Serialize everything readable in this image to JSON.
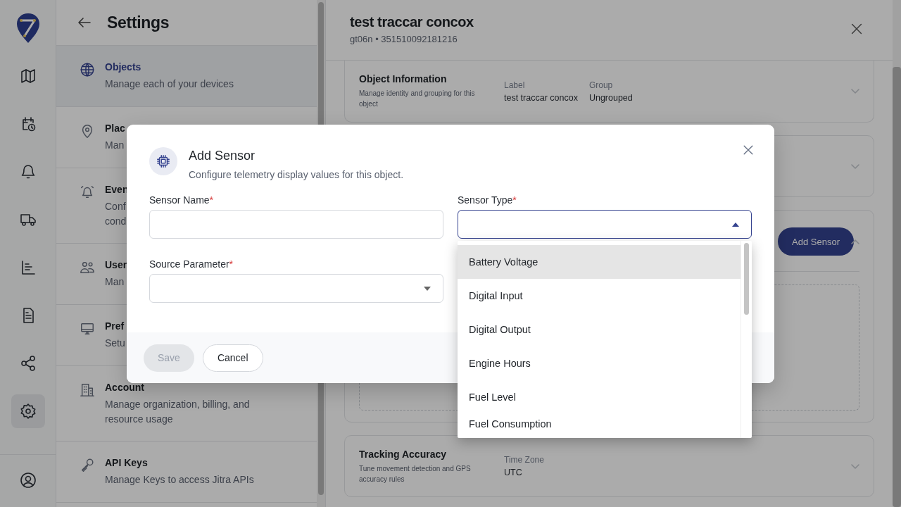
{
  "rail": {
    "items": [
      {
        "selected": false
      },
      {
        "selected": false
      },
      {
        "selected": false
      },
      {
        "selected": false
      },
      {
        "selected": false
      },
      {
        "selected": false
      },
      {
        "selected": false
      },
      {
        "selected": true
      }
    ]
  },
  "settings": {
    "title": "Settings",
    "items": [
      {
        "title": "Objects",
        "description": "Manage each of your devices",
        "selected": true
      },
      {
        "title": "Plac",
        "description": "Man",
        "selected": false
      },
      {
        "title": "Even",
        "description": "Conf\ncond",
        "selected": false
      },
      {
        "title": "User",
        "description": "Man",
        "selected": false
      },
      {
        "title": "Pref",
        "description": "Setu",
        "selected": false
      },
      {
        "title": "Account",
        "description": "Manage organization, billing, and resource usage",
        "selected": false
      },
      {
        "title": "API Keys",
        "description": "Manage Keys to access Jitra APIs",
        "selected": false
      }
    ]
  },
  "detail": {
    "title": "test traccar concox",
    "subtitle": "gt06n • 351510092181216",
    "cards": [
      {
        "kind": "info",
        "title": "Object Information",
        "description": "Manage identity and grouping for this object",
        "fields": [
          {
            "label": "Label",
            "value": "test traccar concox"
          },
          {
            "label": "Group",
            "value": "Ungrouped"
          }
        ],
        "expanded": false
      },
      {
        "kind": "blank",
        "expanded": false
      },
      {
        "kind": "sensors",
        "button": "Add Sensor",
        "expanded": true
      },
      {
        "kind": "info",
        "title": "Tracking Accuracy",
        "description": "Tune movement detection and GPS accuracy rules",
        "fields": [
          {
            "label": "Time Zone",
            "value": "UTC"
          }
        ],
        "expanded": false
      }
    ]
  },
  "dialog": {
    "title": "Add Sensor",
    "subtitle": "Configure telemetry display values for this object.",
    "fields": [
      {
        "kind": "text",
        "label": "Sensor Name",
        "required_mark": "*"
      },
      {
        "kind": "select",
        "label": "Sensor Type",
        "required_mark": "*",
        "open": true
      },
      {
        "kind": "select",
        "label": "Source Parameter",
        "required_mark": "*",
        "open": false
      }
    ],
    "buttons": [
      {
        "label": "Save",
        "disabled": true
      },
      {
        "label": "Cancel",
        "disabled": false
      }
    ],
    "dropdown": {
      "options": [
        {
          "label": "Battery Voltage",
          "highlighted": true
        },
        {
          "label": "Digital Input",
          "highlighted": false
        },
        {
          "label": "Digital Output",
          "highlighted": false
        },
        {
          "label": "Engine Hours",
          "highlighted": false
        },
        {
          "label": "Fuel Level",
          "highlighted": false
        },
        {
          "label": "Fuel Consumption",
          "highlighted": false
        }
      ]
    }
  }
}
